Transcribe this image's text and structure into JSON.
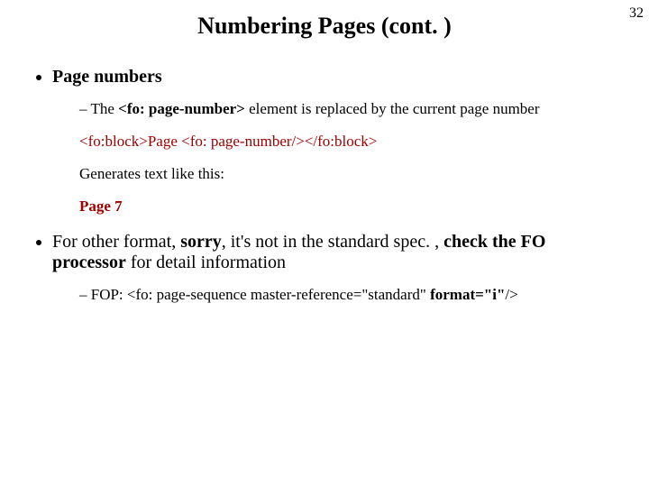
{
  "page_number": "32",
  "title": "Numbering Pages (cont. )",
  "bullet1": {
    "label": "Page numbers",
    "sub_prefix": "The ",
    "sub_tag": "<fo: page-number>",
    "sub_suffix": " element is replaced by the current page number",
    "code": "<fo:block>Page <fo: page-number/></fo:block>",
    "gen_label": "Generates text like this:",
    "gen_example": "Page 7"
  },
  "bullet2": {
    "p1": "For other format, ",
    "p2": "sorry",
    "p3": ", it's not in the standard spec. , ",
    "p4": "check the FO processor",
    "p5": " for detail information",
    "sub_prefix": "FOP: <fo: page-sequence master-reference=\"standard\" ",
    "sub_bold": "format=\"i\"",
    "sub_suffix": "/>"
  }
}
